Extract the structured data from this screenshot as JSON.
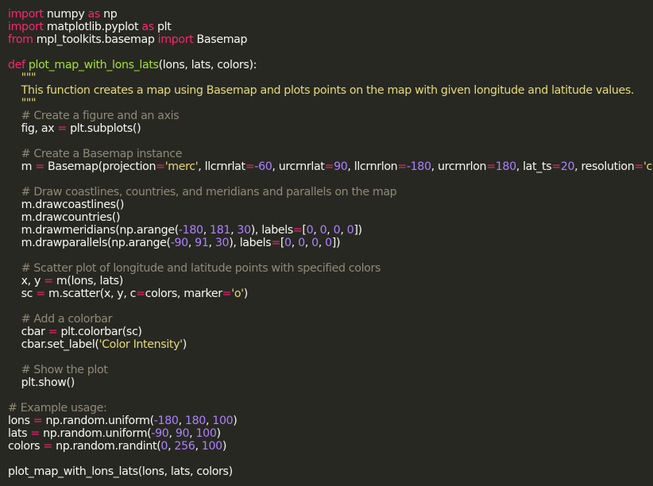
{
  "editor": {
    "colors": {
      "background": "#272822",
      "text": "#f8f8f2",
      "keyword": "#f92672",
      "function": "#a6e22e",
      "string": "#e6db74",
      "number": "#ae81ff",
      "comment": "#8f8a78"
    },
    "lines": [
      [
        [
          "kw",
          "import"
        ],
        [
          "txt",
          " numpy "
        ],
        [
          "kw",
          "as"
        ],
        [
          "txt",
          " np"
        ]
      ],
      [
        [
          "kw",
          "import"
        ],
        [
          "txt",
          " matplotlib.pyplot "
        ],
        [
          "kw",
          "as"
        ],
        [
          "txt",
          " plt"
        ]
      ],
      [
        [
          "kw",
          "from"
        ],
        [
          "txt",
          " mpl_toolkits.basemap "
        ],
        [
          "kw",
          "import"
        ],
        [
          "txt",
          " Basemap"
        ]
      ],
      [],
      [
        [
          "kw",
          "def"
        ],
        [
          "txt",
          " "
        ],
        [
          "fn",
          "plot_map_with_lons_lats"
        ],
        [
          "txt",
          "(lons, lats, colors):"
        ]
      ],
      [
        [
          "str",
          "    \"\"\""
        ]
      ],
      [
        [
          "str",
          "    This function creates a map using Basemap and plots points on the map with given longitude and latitude values."
        ]
      ],
      [
        [
          "str",
          "    \"\"\""
        ]
      ],
      [
        [
          "cm",
          "    # Create a figure and an axis"
        ]
      ],
      [
        [
          "txt",
          "    fig, ax "
        ],
        [
          "op",
          "="
        ],
        [
          "txt",
          " plt.subplots()"
        ]
      ],
      [],
      [
        [
          "cm",
          "    # Create a Basemap instance"
        ]
      ],
      [
        [
          "txt",
          "    m "
        ],
        [
          "op",
          "="
        ],
        [
          "txt",
          " Basemap(projection"
        ],
        [
          "op",
          "="
        ],
        [
          "str",
          "'merc'"
        ],
        [
          "txt",
          ", llcrnrlat"
        ],
        [
          "op",
          "="
        ],
        [
          "num",
          "-60"
        ],
        [
          "txt",
          ", urcrnrlat"
        ],
        [
          "op",
          "="
        ],
        [
          "num",
          "90"
        ],
        [
          "txt",
          ", llcrnrlon"
        ],
        [
          "op",
          "="
        ],
        [
          "num",
          "-180"
        ],
        [
          "txt",
          ", urcrnrlon"
        ],
        [
          "op",
          "="
        ],
        [
          "num",
          "180"
        ],
        [
          "txt",
          ", lat_ts"
        ],
        [
          "op",
          "="
        ],
        [
          "num",
          "20"
        ],
        [
          "txt",
          ", resolution"
        ],
        [
          "op",
          "="
        ],
        [
          "str",
          "'c'"
        ],
        [
          "txt",
          ")"
        ]
      ],
      [],
      [
        [
          "cm",
          "    # Draw coastlines, countries, and meridians and parallels on the map"
        ]
      ],
      [
        [
          "txt",
          "    m.drawcoastlines()"
        ]
      ],
      [
        [
          "txt",
          "    m.drawcountries()"
        ]
      ],
      [
        [
          "txt",
          "    m.drawmeridians(np.arange("
        ],
        [
          "num",
          "-180"
        ],
        [
          "txt",
          ", "
        ],
        [
          "num",
          "181"
        ],
        [
          "txt",
          ", "
        ],
        [
          "num",
          "30"
        ],
        [
          "txt",
          "), labels"
        ],
        [
          "op",
          "="
        ],
        [
          "txt",
          "["
        ],
        [
          "num",
          "0"
        ],
        [
          "txt",
          ", "
        ],
        [
          "num",
          "0"
        ],
        [
          "txt",
          ", "
        ],
        [
          "num",
          "0"
        ],
        [
          "txt",
          ", "
        ],
        [
          "num",
          "0"
        ],
        [
          "txt",
          "])"
        ]
      ],
      [
        [
          "txt",
          "    m.drawparallels(np.arange("
        ],
        [
          "num",
          "-90"
        ],
        [
          "txt",
          ", "
        ],
        [
          "num",
          "91"
        ],
        [
          "txt",
          ", "
        ],
        [
          "num",
          "30"
        ],
        [
          "txt",
          "), labels"
        ],
        [
          "op",
          "="
        ],
        [
          "txt",
          "["
        ],
        [
          "num",
          "0"
        ],
        [
          "txt",
          ", "
        ],
        [
          "num",
          "0"
        ],
        [
          "txt",
          ", "
        ],
        [
          "num",
          "0"
        ],
        [
          "txt",
          ", "
        ],
        [
          "num",
          "0"
        ],
        [
          "txt",
          "])"
        ]
      ],
      [],
      [
        [
          "cm",
          "    # Scatter plot of longitude and latitude points with specified colors"
        ]
      ],
      [
        [
          "txt",
          "    x, y "
        ],
        [
          "op",
          "="
        ],
        [
          "txt",
          " m(lons, lats)"
        ]
      ],
      [
        [
          "txt",
          "    sc "
        ],
        [
          "op",
          "="
        ],
        [
          "txt",
          " m.scatter(x, y, c"
        ],
        [
          "op",
          "="
        ],
        [
          "txt",
          "colors, marker"
        ],
        [
          "op",
          "="
        ],
        [
          "str",
          "'o'"
        ],
        [
          "txt",
          ")"
        ]
      ],
      [],
      [
        [
          "cm",
          "    # Add a colorbar"
        ]
      ],
      [
        [
          "txt",
          "    cbar "
        ],
        [
          "op",
          "="
        ],
        [
          "txt",
          " plt.colorbar(sc)"
        ]
      ],
      [
        [
          "txt",
          "    cbar.set_label("
        ],
        [
          "str",
          "'Color Intensity'"
        ],
        [
          "txt",
          ")"
        ]
      ],
      [],
      [
        [
          "cm",
          "    # Show the plot"
        ]
      ],
      [
        [
          "txt",
          "    plt.show()"
        ]
      ],
      [],
      [
        [
          "cm",
          "# Example usage:"
        ]
      ],
      [
        [
          "txt",
          "lons "
        ],
        [
          "op",
          "="
        ],
        [
          "txt",
          " np.random.uniform("
        ],
        [
          "num",
          "-180"
        ],
        [
          "txt",
          ", "
        ],
        [
          "num",
          "180"
        ],
        [
          "txt",
          ", "
        ],
        [
          "num",
          "100"
        ],
        [
          "txt",
          ")"
        ]
      ],
      [
        [
          "txt",
          "lats "
        ],
        [
          "op",
          "="
        ],
        [
          "txt",
          " np.random.uniform("
        ],
        [
          "num",
          "-90"
        ],
        [
          "txt",
          ", "
        ],
        [
          "num",
          "90"
        ],
        [
          "txt",
          ", "
        ],
        [
          "num",
          "100"
        ],
        [
          "txt",
          ")"
        ]
      ],
      [
        [
          "txt",
          "colors "
        ],
        [
          "op",
          "="
        ],
        [
          "txt",
          " np.random.randint("
        ],
        [
          "num",
          "0"
        ],
        [
          "txt",
          ", "
        ],
        [
          "num",
          "256"
        ],
        [
          "txt",
          ", "
        ],
        [
          "num",
          "100"
        ],
        [
          "txt",
          ")"
        ]
      ],
      [],
      [
        [
          "txt",
          "plot_map_with_lons_lats(lons, lats, colors)"
        ]
      ]
    ]
  }
}
